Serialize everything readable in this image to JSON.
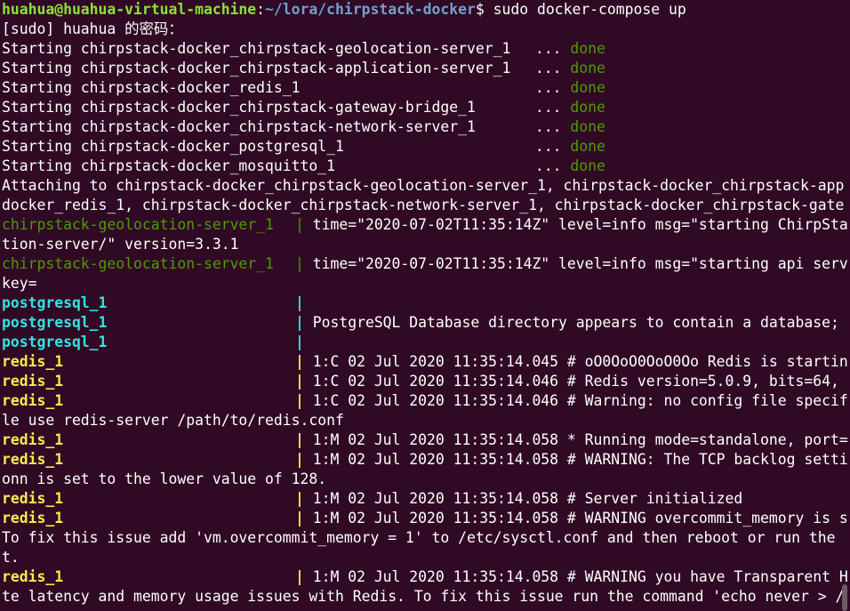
{
  "prompt": {
    "user_host": "huahua@huahua-virtual-machine",
    "path": "~/lora/chirpstack-docker",
    "symbol": "$",
    "command": " sudo docker-compose up"
  },
  "sudo_prompt": "[sudo] huahua 的密码：",
  "starting": [
    {
      "name": "Starting chirpstack-docker_chirpstack-geolocation-server_1",
      "dots": " ... ",
      "status": "done"
    },
    {
      "name": "Starting chirpstack-docker_chirpstack-application-server_1",
      "dots": " ... ",
      "status": "done"
    },
    {
      "name": "Starting chirpstack-docker_redis_1",
      "dots": " ... ",
      "status": "done"
    },
    {
      "name": "Starting chirpstack-docker_chirpstack-gateway-bridge_1",
      "dots": " ... ",
      "status": "done"
    },
    {
      "name": "Starting chirpstack-docker_chirpstack-network-server_1",
      "dots": " ... ",
      "status": "done"
    },
    {
      "name": "Starting chirpstack-docker_postgresql_1",
      "dots": " ... ",
      "status": "done"
    },
    {
      "name": "Starting chirpstack-docker_mosquitto_1",
      "dots": " ... ",
      "status": "done"
    }
  ],
  "attaching": [
    "Attaching to chirpstack-docker_chirpstack-geolocation-server_1, chirpstack-docker_chirpstack-app",
    "docker_redis_1, chirpstack-docker_chirpstack-network-server_1, chirpstack-docker_chirpstack-gate"
  ],
  "logs": [
    {
      "service": "chirpstack-geolocation-server_1",
      "color": "green",
      "text": " time=\"2020-07-02T11:35:14Z\" level=info msg=\"starting ChirpSta"
    },
    {
      "service": "",
      "color": "plain",
      "text": "tion-server/\" version=3.3.1"
    },
    {
      "service": "chirpstack-geolocation-server_1",
      "color": "green",
      "text": " time=\"2020-07-02T11:35:14Z\" level=info msg=\"starting api serv"
    },
    {
      "service": "",
      "color": "plain",
      "text": "key="
    },
    {
      "service": "postgresql_1",
      "color": "cyan",
      "text": ""
    },
    {
      "service": "postgresql_1",
      "color": "cyan",
      "text": " PostgreSQL Database directory appears to contain a database;"
    },
    {
      "service": "postgresql_1",
      "color": "cyan",
      "text": ""
    },
    {
      "service": "redis_1",
      "color": "yellow",
      "text": " 1:C 02 Jul 2020 11:35:14.045 # oO0OoO0OoO0Oo Redis is startin"
    },
    {
      "service": "redis_1",
      "color": "yellow",
      "text": " 1:C 02 Jul 2020 11:35:14.046 # Redis version=5.0.9, bits=64,"
    },
    {
      "service": "redis_1",
      "color": "yellow",
      "text": " 1:C 02 Jul 2020 11:35:14.046 # Warning: no config file specif"
    },
    {
      "service": "",
      "color": "plain",
      "text": "le use redis-server /path/to/redis.conf"
    },
    {
      "service": "redis_1",
      "color": "yellow",
      "text": " 1:M 02 Jul 2020 11:35:14.058 * Running mode=standalone, port="
    },
    {
      "service": "redis_1",
      "color": "yellow",
      "text": " 1:M 02 Jul 2020 11:35:14.058 # WARNING: The TCP backlog setti"
    },
    {
      "service": "",
      "color": "plain",
      "text": "onn is set to the lower value of 128."
    },
    {
      "service": "redis_1",
      "color": "yellow",
      "text": " 1:M 02 Jul 2020 11:35:14.058 # Server initialized"
    },
    {
      "service": "redis_1",
      "color": "yellow",
      "text": " 1:M 02 Jul 2020 11:35:14.058 # WARNING overcommit_memory is s"
    },
    {
      "service": "",
      "color": "plain",
      "text": "To fix this issue add 'vm.overcommit_memory = 1' to /etc/sysctl.conf and then reboot or run the"
    },
    {
      "service": "",
      "color": "plain",
      "text": "t."
    },
    {
      "service": "redis_1",
      "color": "yellow",
      "text": " 1:M 02 Jul 2020 11:35:14.058 # WARNING you have Transparent H"
    },
    {
      "service": "",
      "color": "plain",
      "text": "te latency and memory usage issues with Redis. To fix this issue run the command 'echo never > /"
    }
  ],
  "colors": {
    "background": "#300a24",
    "prompt_user": "#8ae234",
    "prompt_path": "#729fcf",
    "done": "#4e9a06",
    "service_green": "#4e9a06",
    "service_cyan": "#34e2e2",
    "service_yellow": "#fce94f"
  }
}
